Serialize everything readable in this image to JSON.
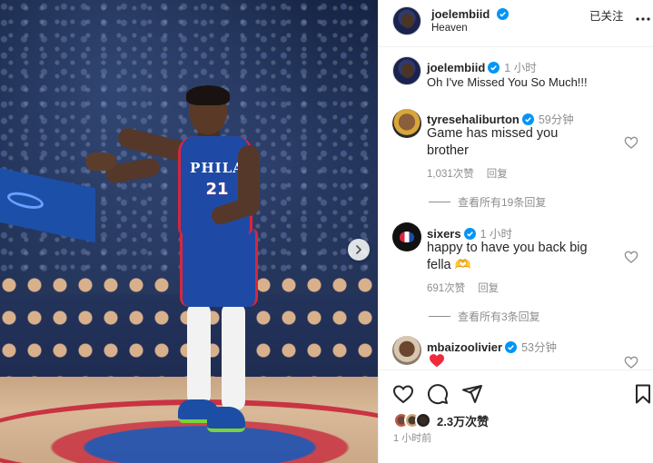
{
  "header": {
    "username": "joelembiid",
    "subtitle": "Heaven",
    "follow_label": "已关注",
    "more_icon": "more-horizontal-icon"
  },
  "caption": {
    "username": "joelembiid",
    "time": "1 小时",
    "text": "Oh I've Missed You So Much!!!"
  },
  "comments": [
    {
      "username": "tyresehaliburton",
      "time": "59分钟",
      "text_line1": "Game has missed you",
      "text_line2": "brother",
      "likes": "1,031次赞",
      "reply_label": "回复",
      "view_replies": "查看所有19条回复"
    },
    {
      "username": "sixers",
      "time": "1 小时",
      "text_line1": "happy to have you back big",
      "text_line2": "fella 🫶",
      "likes": "691次赞",
      "reply_label": "回复",
      "view_replies": "查看所有3条回复"
    },
    {
      "username": "mbaizoolivier",
      "time": "53分钟",
      "text_line1": "❤️"
    }
  ],
  "footer": {
    "likes_count": "2.3万次赞",
    "post_time": "1 小时前"
  },
  "photo": {
    "jersey_team": "PHILA",
    "jersey_number": "21"
  },
  "colors": {
    "verified": "#0095f6",
    "heart": "#ed4956",
    "muted_text": "#8e8e8e",
    "jersey_blue": "#1e4aa6",
    "jersey_red": "#d7263d"
  }
}
